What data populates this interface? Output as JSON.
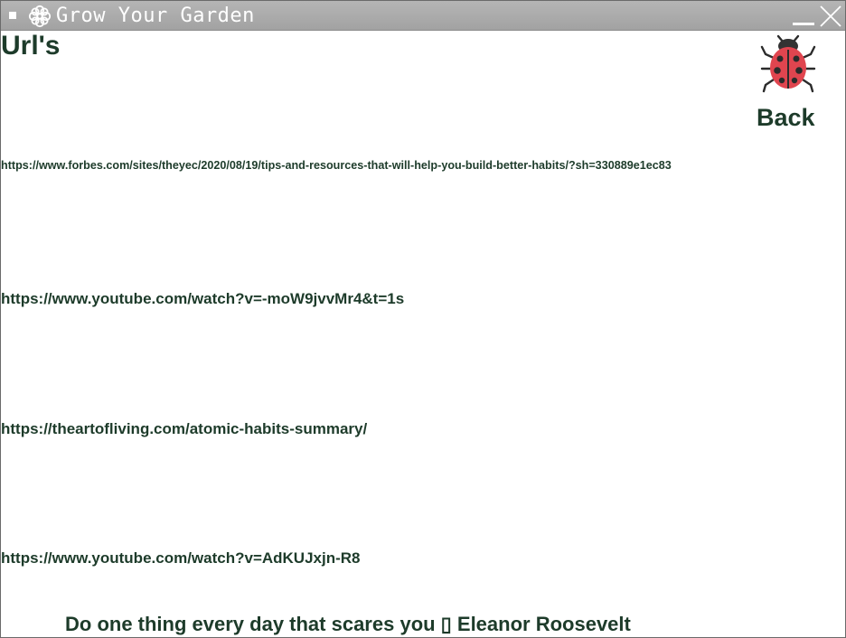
{
  "window": {
    "title": "Grow Your Garden",
    "app_icon": "flower-icon"
  },
  "header": {
    "title": "Url's"
  },
  "back_button": {
    "label": "Back",
    "icon": "ladybug-icon"
  },
  "links": [
    {
      "url": "https://www.forbes.com/sites/theyec/2020/08/19/tips-and-resources-that-will-help-you-build-better-habits/?sh=330889e1ec83"
    },
    {
      "url": "https://www.youtube.com/watch?v=-moW9jvvMr4&t=1s"
    },
    {
      "url": "https://theartofliving.com/atomic-habits-summary/"
    },
    {
      "url": "https://www.youtube.com/watch?v=AdKUJxjn-R8"
    }
  ],
  "quote": {
    "text": "Do one thing every day that scares you ▯ Eleanor Roosevelt"
  },
  "colors": {
    "text": "#1d3b2a",
    "titlebar": "#a8a8a8",
    "background": "#ffffff",
    "ladybug": "#e0454f"
  }
}
